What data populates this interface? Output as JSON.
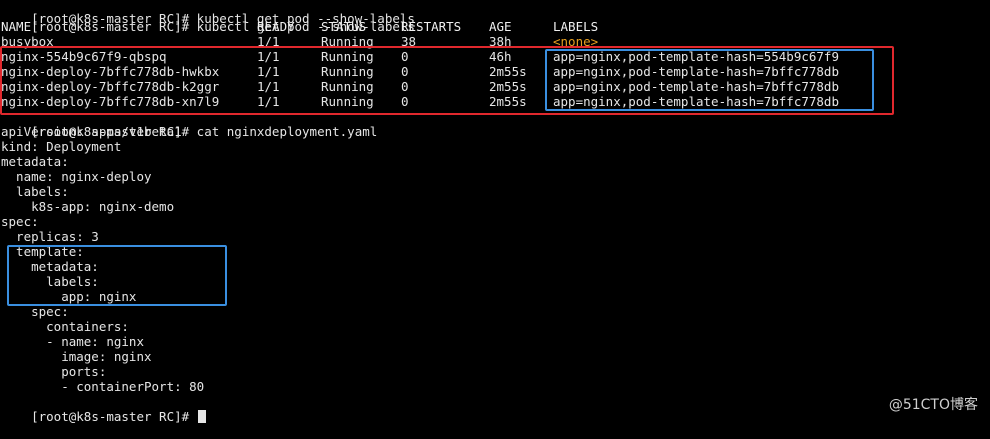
{
  "terminal": {
    "top_partial": "[root@k8s-master RC]# kubectl get pod --show-labels",
    "prompt_cmd": "[root@k8s-master RC]# kubectl get pod --show-labels",
    "headers": {
      "name": "NAME",
      "ready": "READY",
      "status": "STATUS",
      "restarts": "RESTARTS",
      "age": "AGE",
      "labels": "LABELS"
    },
    "rows": [
      {
        "name": "busybox",
        "ready": "1/1",
        "status": "Running",
        "restarts": "38",
        "age": "38h",
        "labels": "<none>"
      },
      {
        "name": "nginx-554b9c67f9-qbspq",
        "ready": "1/1",
        "status": "Running",
        "restarts": "0",
        "age": "46h",
        "labels": "app=nginx,pod-template-hash=554b9c67f9"
      },
      {
        "name": "nginx-deploy-7bffc778db-hwkbx",
        "ready": "1/1",
        "status": "Running",
        "restarts": "0",
        "age": "2m55s",
        "labels": "app=nginx,pod-template-hash=7bffc778db"
      },
      {
        "name": "nginx-deploy-7bffc778db-k2ggr",
        "ready": "1/1",
        "status": "Running",
        "restarts": "0",
        "age": "2m55s",
        "labels": "app=nginx,pod-template-hash=7bffc778db"
      },
      {
        "name": "nginx-deploy-7bffc778db-xn7l9",
        "ready": "1/1",
        "status": "Running",
        "restarts": "0",
        "age": "2m55s",
        "labels": "app=nginx,pod-template-hash=7bffc778db"
      }
    ],
    "cat_cmd": "[root@k8s-master RC]# cat nginxdeployment.yaml",
    "yaml_lines": [
      "apiVersion: apps/v1beta1",
      "kind: Deployment",
      "metadata:",
      "  name: nginx-deploy",
      "  labels:",
      "    k8s-app: nginx-demo",
      "spec:",
      "  replicas: 3",
      "  template:",
      "    metadata:",
      "      labels:",
      "        app: nginx",
      "    spec:",
      "      containers:",
      "      - name: nginx",
      "        image: nginx",
      "        ports:",
      "        - containerPort: 80"
    ],
    "final_prompt": "[root@k8s-master RC]# "
  },
  "watermark": "@51CTO博客",
  "colors": {
    "background": "#000000",
    "text": "#e6e6e6",
    "none_label": "#e8a020",
    "red_highlight": "#e0282d",
    "blue_highlight": "#3a8fe0"
  }
}
